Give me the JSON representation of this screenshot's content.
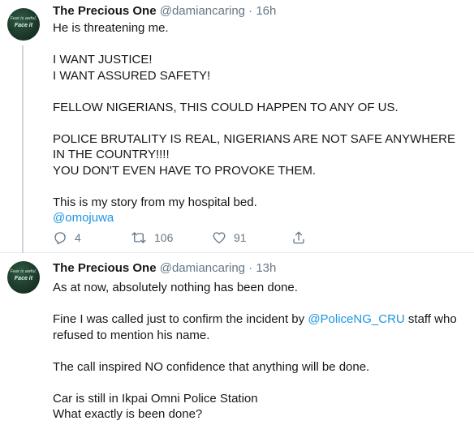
{
  "tweets": [
    {
      "author": {
        "name": "The Precious One",
        "handle": "@damiancaring",
        "avatar_text_top": "Fear is awful,",
        "avatar_text_bottom": "Face it"
      },
      "separator": "·",
      "time": "16h",
      "lines": {
        "l1": "He is threatening me.",
        "l2": "I WANT JUSTICE!",
        "l3": "I WANT ASSURED SAFETY!",
        "l4": "FELLOW NIGERIANS, THIS COULD HAPPEN TO ANY OF US.",
        "l5": "POLICE BRUTALITY IS REAL, NIGERIANS ARE NOT SAFE ANYWHERE IN THE COUNTRY!!!!",
        "l6": "YOU DON'T EVEN HAVE TO PROVOKE THEM.",
        "l7": "This is my story from my hospital bed.",
        "mention": "@omojuwa"
      },
      "actions": {
        "reply_count": "4",
        "retweet_count": "106",
        "like_count": "91"
      }
    },
    {
      "author": {
        "name": "The Precious One",
        "handle": "@damiancaring",
        "avatar_text_top": "Fear is awful,",
        "avatar_text_bottom": "Face it"
      },
      "separator": "·",
      "time": "13h",
      "lines": {
        "l1": "As at now, absolutely nothing has been done.",
        "l2a": "Fine I was called just to confirm the incident by ",
        "mention": "@PoliceNG_CRU",
        "l2b": " staff who refused to mention his name.",
        "l3": "The call inspired NO confidence that anything will be done.",
        "l4": "Car is still in Ikpai Omni Police Station",
        "l5": "What exactly is been done?"
      }
    }
  ],
  "colors": {
    "text": "#14171a",
    "secondary": "#657786",
    "link": "#1b95e0",
    "divider": "#e6ecf0"
  },
  "icons": [
    "reply-icon",
    "retweet-icon",
    "like-icon",
    "share-icon"
  ]
}
